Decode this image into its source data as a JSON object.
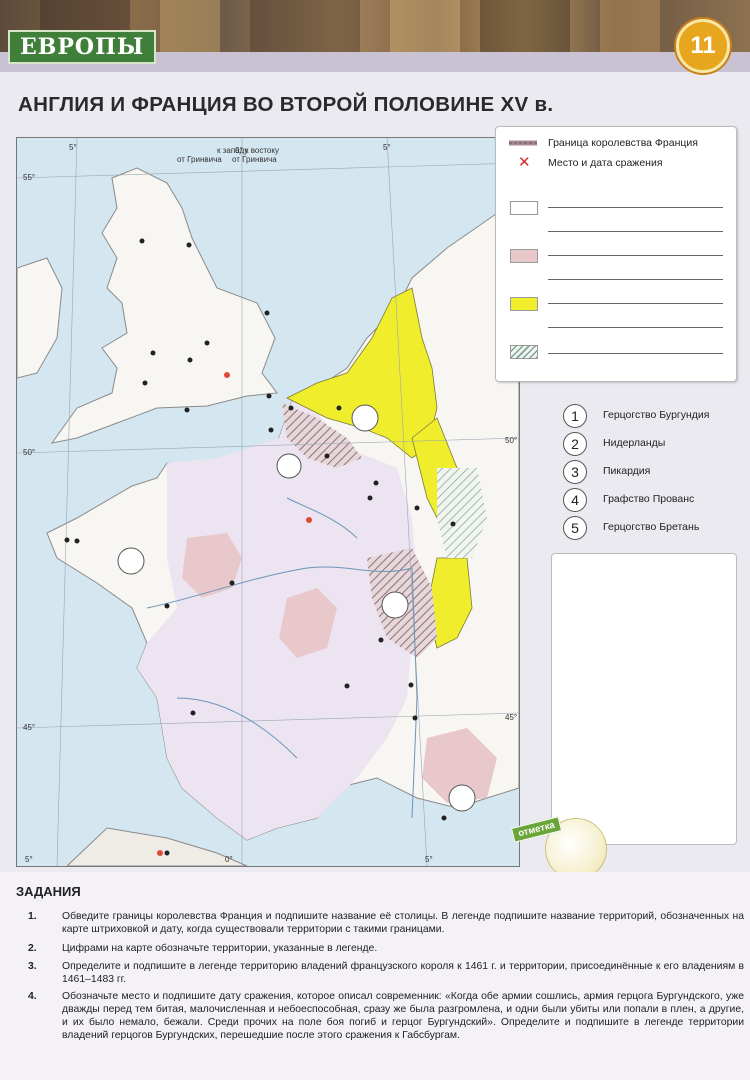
{
  "header": {
    "series_label": "ЕВРОПЫ",
    "page_number": "11"
  },
  "title": "АНГЛИЯ И ФРАНЦИЯ ВО ВТОРОЙ ПОЛОВИНЕ XV в.",
  "map": {
    "meridian_west": "к западу",
    "meridian_west2": "от Гринвича",
    "meridian_zero": "0°",
    "meridian_east": "к востоку",
    "meridian_east2": "от Гринвича",
    "lat_55": "55°",
    "lat_50": "50°",
    "lat_45": "45°",
    "lon_5w": "5°",
    "lon_5e": "5°",
    "lat_50r": "50°",
    "lat_45r": "45°",
    "lon_5w_bottom": "5°",
    "lon_0_bottom": "0°",
    "lon_5e_bottom": "5°",
    "colors": {
      "sea": "#d4e6ef",
      "land": "#f7f6f2",
      "yellow": "#f0ee2c",
      "pink": "#e9c8cc",
      "lavender": "#ece4f0",
      "hatch": "#9c7f86"
    }
  },
  "legend": {
    "border_label": "Граница королевства Франция",
    "battle_label": "Место и дата сражения",
    "swatches": [
      "white",
      "pink",
      "yellow",
      "hatched"
    ]
  },
  "territories": [
    {
      "num": "1",
      "label": "Герцогство Бургундия"
    },
    {
      "num": "2",
      "label": "Нидерланды"
    },
    {
      "num": "3",
      "label": "Пикардия"
    },
    {
      "num": "4",
      "label": "Графство Прованс"
    },
    {
      "num": "5",
      "label": "Герцогство Бретань"
    }
  ],
  "stamp_label": "отметка",
  "tasks": {
    "heading": "ЗАДАНИЯ",
    "items": [
      {
        "num": "1.",
        "text": "Обведите границы королевства Франция и подпишите название её столицы. В легенде подпишите название территорий, обозначенных на карте штриховкой и дату, когда существовали территории с такими границами."
      },
      {
        "num": "2.",
        "text": "Цифрами на карте обозначьте территории, указанные в легенде."
      },
      {
        "num": "3.",
        "text": "Определите и подпишите в легенде территорию владений французского короля к 1461 г. и территории, присоединённые к его владениям в 1461–1483 гг."
      },
      {
        "num": "4.",
        "text": "Обозначьте место и подпишите дату сражения, которое описал современник: «Когда обе армии сошлись, армия герцога Бургундского, уже дважды перед тем битая, малочисленная и небоеспособная, сразу же была разгромлена, и одни были убиты или попали в плен, а другие, и их было немало, бежали. Среди прочих на поле боя погиб и герцог Бургундский». Определите и подпишите в легенде территории владений герцогов Бургундских, перешедшие после этого сражения к Габсбургам."
      }
    ]
  }
}
